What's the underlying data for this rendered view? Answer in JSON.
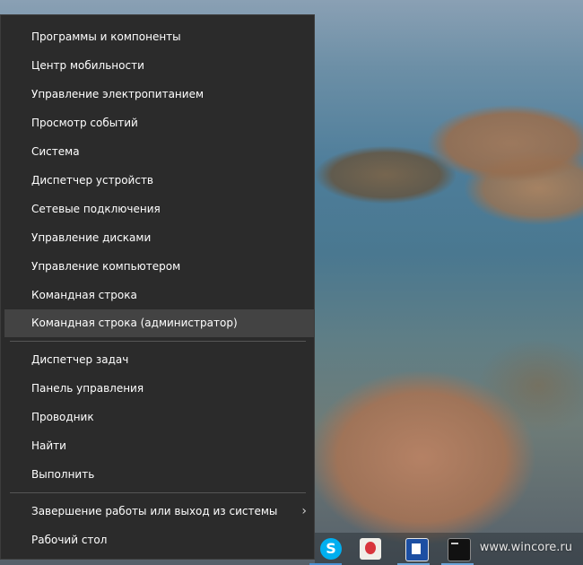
{
  "menu": {
    "group1": [
      "Программы и компоненты",
      "Центр мобильности",
      "Управление электропитанием",
      "Просмотр событий",
      "Система",
      "Диспетчер устройств",
      "Сетевые подключения",
      "Управление дисками",
      "Управление компьютером",
      "Командная строка",
      "Командная строка (администратор)"
    ],
    "group2": [
      "Диспетчер задач",
      "Панель управления",
      "Проводник",
      "Найти",
      "Выполнить"
    ],
    "group3": [
      "Завершение работы или выход из системы",
      "Рабочий стол"
    ],
    "highlighted_index": 10
  },
  "taskbar": {
    "skype_letter": "S",
    "icons": [
      "skype-icon",
      "paint-icon",
      "solitaire-icon",
      "cmd-icon"
    ]
  },
  "watermark": "www.wincore.ru",
  "colors": {
    "menu_bg": "#2b2b2b",
    "highlight_bg": "#434343",
    "text": "#ffffff"
  }
}
